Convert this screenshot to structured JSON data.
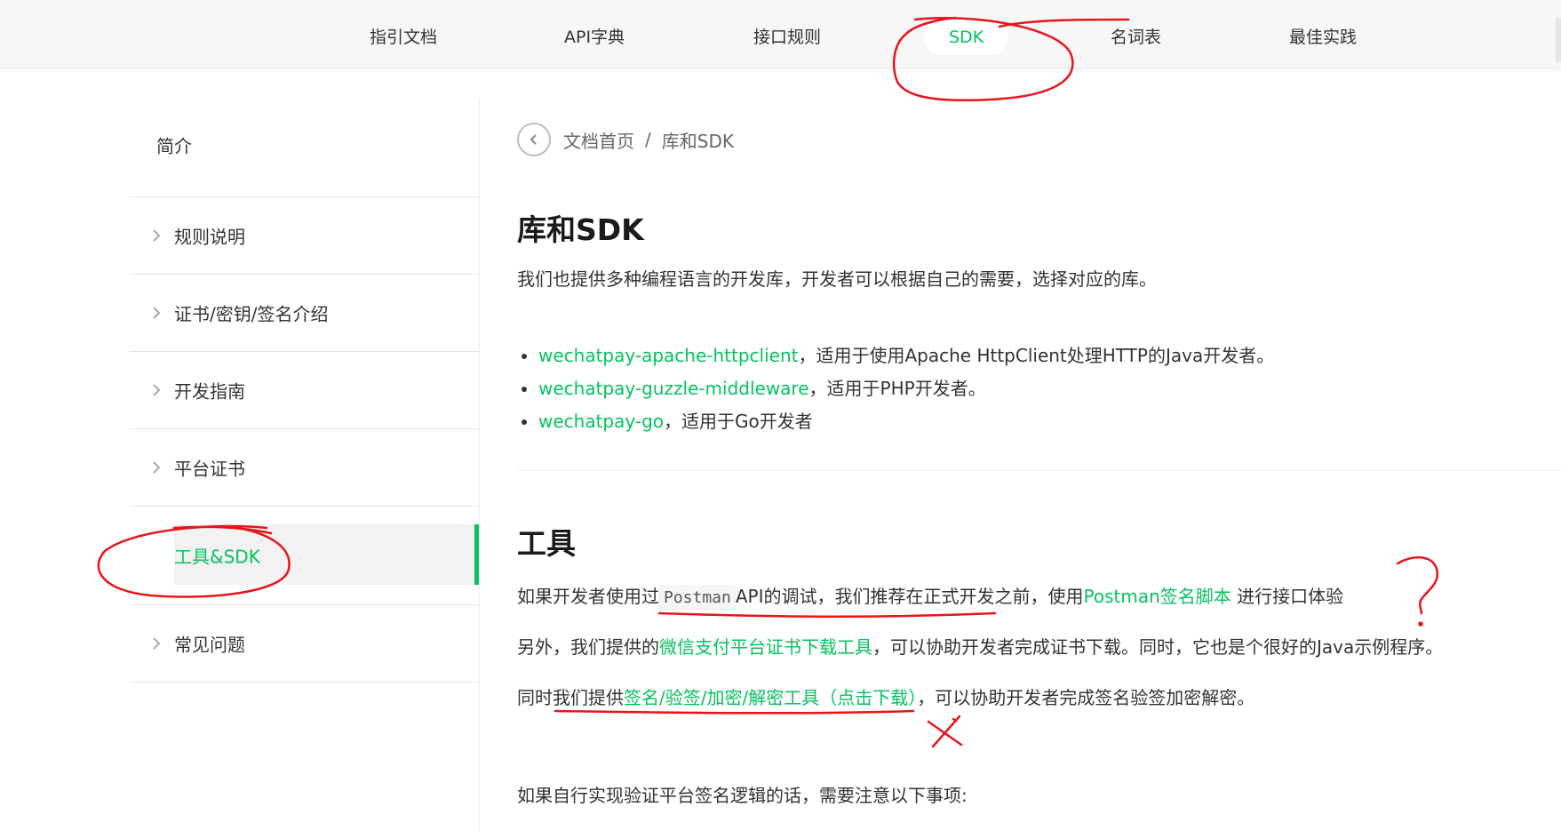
{
  "topnav": {
    "tabs": [
      {
        "label": "指引文档"
      },
      {
        "label": "API字典"
      },
      {
        "label": "接口规则"
      },
      {
        "label": "SDK",
        "active": true
      },
      {
        "label": "名词表"
      },
      {
        "label": "最佳实践"
      }
    ]
  },
  "sidebar": {
    "items": [
      {
        "label": "简介"
      },
      {
        "label": "规则说明"
      },
      {
        "label": "证书/密钥/签名介绍"
      },
      {
        "label": "开发指南"
      },
      {
        "label": "平台证书"
      },
      {
        "label": "工具&SDK",
        "active": true
      },
      {
        "label": "常见问题"
      }
    ]
  },
  "breadcrumb": {
    "home": "文档首页",
    "separator": "/",
    "current": "库和SDK"
  },
  "section_sdk": {
    "title": "库和SDK",
    "intro": "我们也提供多种编程语言的开发库，开发者可以根据自己的需要，选择对应的库。",
    "libs": [
      {
        "name": "wechatpay-apache-httpclient",
        "desc": "，适用于使用Apache HttpClient处理HTTP的Java开发者。"
      },
      {
        "name": "wechatpay-guzzle-middleware",
        "desc": "，适用于PHP开发者。"
      },
      {
        "name": "wechatpay-go",
        "desc": "，适用于Go开发者"
      }
    ]
  },
  "section_tools": {
    "title": "工具",
    "p1": {
      "a": "如果开发者使用过",
      "code": "Postman",
      "b": "API的调试，我们推荐在正式开发之前，使用",
      "link": "Postman签名脚本",
      "c": " 进行接口体验"
    },
    "p2": {
      "a": "另外，我们提供的",
      "link": "微信支付平台证书下载工具",
      "b": "，可以协助开发者完成证书下载。同时，它也是个很好的Java示例程序。"
    },
    "p3": {
      "a": "同时我们提供",
      "link": "签名/验签/加密/解密工具（点击下载）",
      "b": "，可以协助开发者完成签名验签加密解密。"
    },
    "p4": "如果自行实现验证平台签名逻辑的话，需要注意以下事项:"
  },
  "colors": {
    "accent": "#07c160",
    "annotation": "#e8141b"
  }
}
